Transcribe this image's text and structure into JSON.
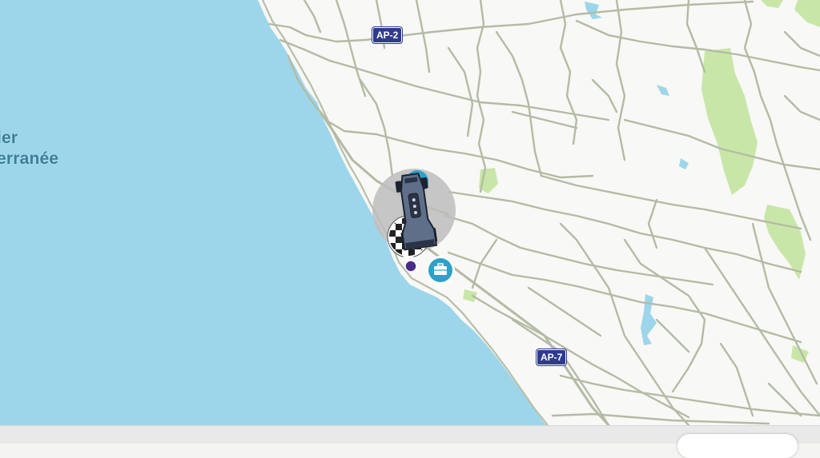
{
  "map": {
    "sea_label": {
      "line1": "ier",
      "line2": "erranée"
    },
    "road_shields": [
      {
        "id": "ap2",
        "label": "AP-2"
      },
      {
        "id": "ap7",
        "label": "AP-7"
      }
    ]
  },
  "colors": {
    "sea": "#9dd6ea",
    "land": "#f8f8f6",
    "road": "#b7bfa8",
    "park": "#c9e6a9",
    "marker_blue": "#2ba2c9",
    "destination_purple": "#4a2a8a",
    "shield_blue": "#2f3a8f"
  },
  "icons": {
    "car": "race-car-icon",
    "destination": "checkered-flag-icon",
    "work": "briefcase-icon",
    "pin": "location-pin-icon"
  }
}
